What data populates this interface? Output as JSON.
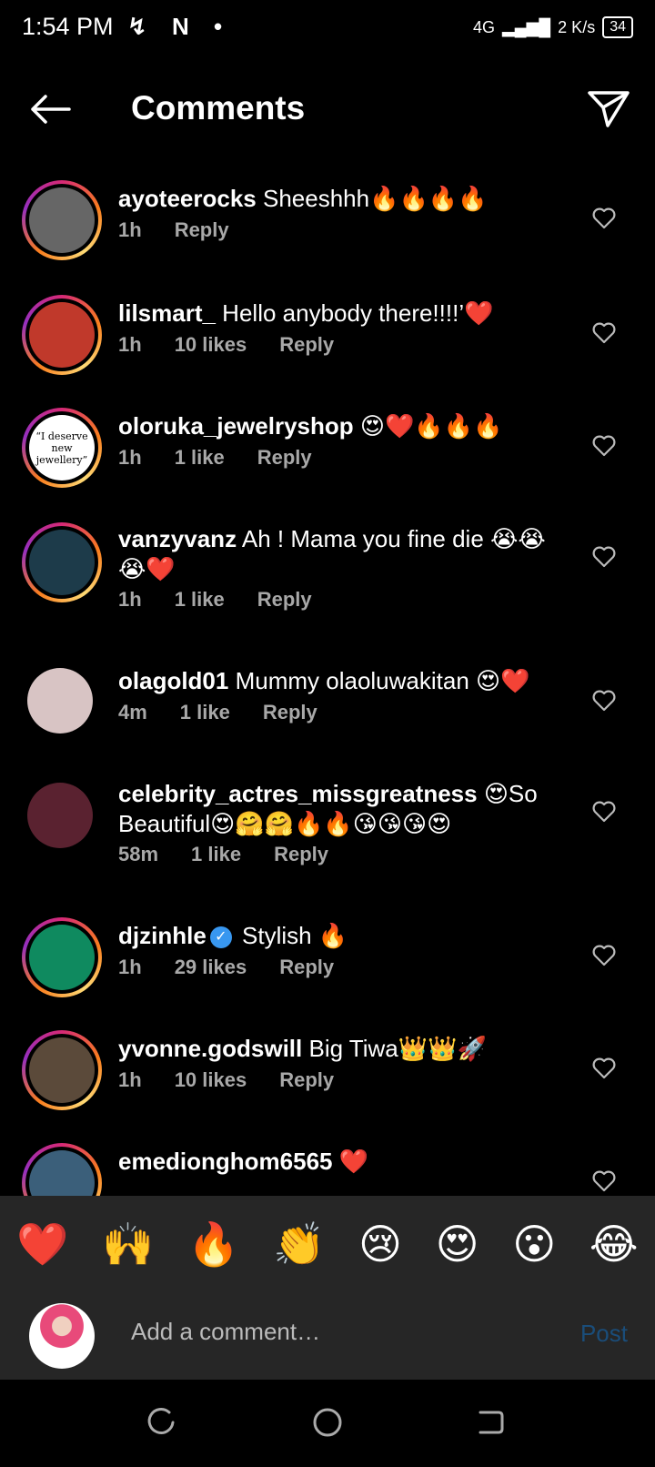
{
  "status_bar": {
    "time": "1:54 PM",
    "left_icons": "↯ N •",
    "network": "4G",
    "speed": "2 K/s",
    "battery": "34"
  },
  "header": {
    "title": "Comments",
    "back_icon": "back-arrow-icon",
    "send_icon": "send-icon"
  },
  "comments": [
    {
      "username": "ayoteerocks",
      "text": "Sheeshhh🔥🔥🔥🔥",
      "time": "1h",
      "likes": "",
      "reply": "Reply",
      "ring": true,
      "avatar_color": "#666"
    },
    {
      "username": "lilsmart_",
      "text": "Hello anybody there!!!!’❤️",
      "time": "1h",
      "likes": "10 likes",
      "reply": "Reply",
      "ring": true,
      "avatar_color": "#c0392b"
    },
    {
      "username": "oloruka_jewelryshop",
      "text": "😍❤️🔥🔥🔥",
      "time": "1h",
      "likes": "1 like",
      "reply": "Reply",
      "ring": true,
      "avatar_color": "#ffffff",
      "avatar_text": "“I deserve new jewellery”"
    },
    {
      "username": "vanzyvanz",
      "text": "Ah ! Mama you fine die 😭😭😭❤️",
      "time": "1h",
      "likes": "1 like",
      "reply": "Reply",
      "ring": true,
      "avatar_color": "#1d3b4a"
    },
    {
      "username": "olagold01",
      "text": "Mummy olaoluwakitan 😍❤️",
      "time": "4m",
      "likes": "1 like",
      "reply": "Reply",
      "ring": false,
      "avatar_color": "#d8c4c4"
    },
    {
      "username": "celebrity_actres_missgreatness",
      "text": "😍So Beautiful😍🤗🤗🔥🔥😘😘😘😍",
      "time": "58m",
      "likes": "1 like",
      "reply": "Reply",
      "ring": false,
      "avatar_color": "#5a2230"
    },
    {
      "username": "djzinhle",
      "verified": true,
      "text": "Stylish 🔥",
      "time": "1h",
      "likes": "29 likes",
      "reply": "Reply",
      "ring": true,
      "avatar_color": "#0f8a5f"
    },
    {
      "username": "yvonne.godswill",
      "text": "Big Tiwa👑👑🚀",
      "time": "1h",
      "likes": "10 likes",
      "reply": "Reply",
      "ring": true,
      "avatar_color": "#5b4a3a"
    },
    {
      "username": "emedionghom6565",
      "text": "❤️",
      "time": "",
      "likes": "",
      "reply": "",
      "ring": true,
      "avatar_color": "#3b5f7a"
    }
  ],
  "reactions": [
    "❤️",
    "🙌",
    "🔥",
    "👏",
    "😢",
    "😍",
    "😮",
    "😂"
  ],
  "composer": {
    "placeholder": "Add a comment…",
    "post_label": "Post"
  },
  "nav": {
    "recents_icon": "recents-icon",
    "home_icon": "home-icon",
    "back_icon": "nav-back-icon"
  }
}
